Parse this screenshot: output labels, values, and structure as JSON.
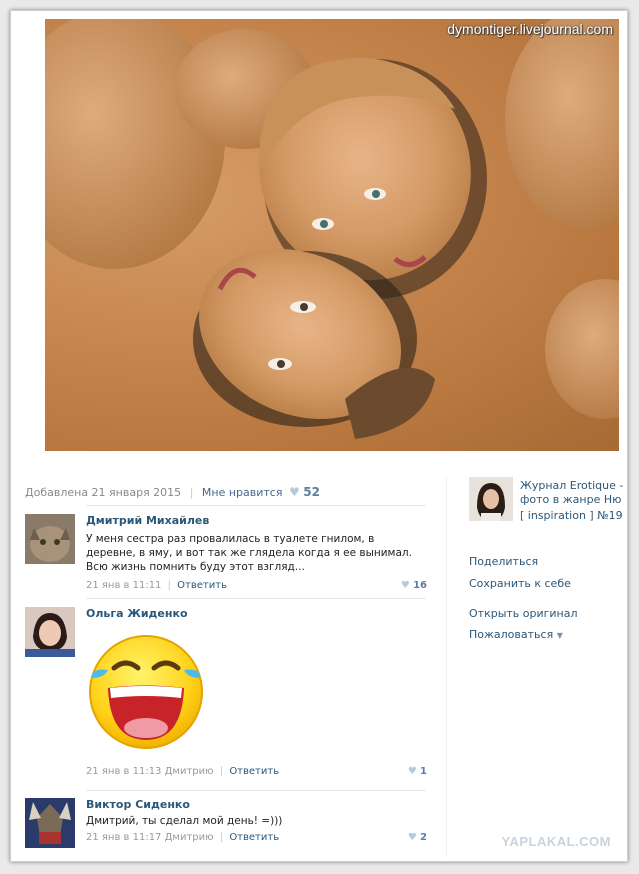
{
  "photo": {
    "watermark": "dymontiger.livejournal.com"
  },
  "meta": {
    "added": "Добавлена 21 января 2015",
    "like_label": "Мне нравится",
    "like_count": "52"
  },
  "comments": [
    {
      "name": "Дмитрий Михайлев",
      "text": "У меня сестра раз провалилась в туалете гнилом, в деревне, в яму, и вот так же глядела когда я ее вынимал. Всю жизнь помнить буду этот взгляд...",
      "date": "21 янв в 11:11",
      "reply_to": "",
      "reply": "Ответить",
      "likes": "16"
    },
    {
      "name": "Ольга Жиденко",
      "text": "",
      "date": "21 янв в 11:13",
      "reply_to": "Дмитрию",
      "reply": "Ответить",
      "likes": "1"
    },
    {
      "name": "Виктор Сиденко",
      "text": "Дмитрий, ты сделал мой день! =)))",
      "date": "21 янв в 11:17",
      "reply_to": "Дмитрию",
      "reply": "Ответить",
      "likes": "2"
    }
  ],
  "sidebar": {
    "album_title": "Журнал Erotique - фото в жанре Ню",
    "album_tag": "inspiration",
    "album_number": "№19",
    "share": "Поделиться",
    "save": "Сохранить к себе",
    "open_original": "Открыть оригинал",
    "report": "Пожаловаться"
  },
  "footer_watermark": "YAPLAKAL.COM"
}
